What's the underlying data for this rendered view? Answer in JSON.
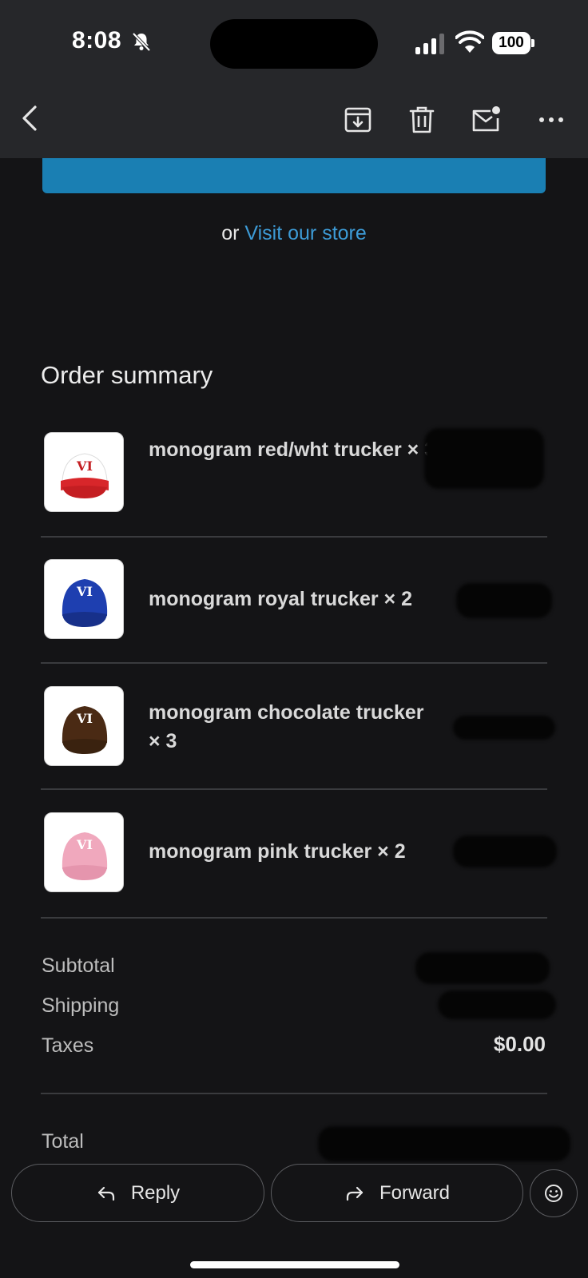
{
  "status_bar": {
    "time": "8:08",
    "battery": "100"
  },
  "toolbar": {
    "back_icon": "chevron-left-icon",
    "archive_icon": "archive-icon",
    "delete_icon": "trash-icon",
    "mark_unread_icon": "mail-unread-icon",
    "more_icon": "more-horizontal-icon"
  },
  "email": {
    "store_prefix": "or",
    "store_link": "Visit our store",
    "order_summary_title": "Order summary",
    "items": [
      {
        "name": "monogram red/wht trucker × 3",
        "cap_color": "#d8262a",
        "cap_front": "#ffffff"
      },
      {
        "name": "monogram royal trucker × 2",
        "cap_color": "#1e3fb0",
        "cap_front": "#1e3fb0"
      },
      {
        "name": "monogram chocolate trucker × 3",
        "cap_color": "#4a2a14",
        "cap_front": "#4a2a14"
      },
      {
        "name": "monogram pink trucker × 2",
        "cap_color": "#f0a8bd",
        "cap_front": "#f0a8bd"
      }
    ],
    "totals": {
      "subtotal_label": "Subtotal",
      "shipping_label": "Shipping",
      "taxes_label": "Taxes",
      "taxes_value": "$0.00",
      "total_label": "Total"
    }
  },
  "actions": {
    "reply_label": "Reply",
    "forward_label": "Forward",
    "emoji_icon": "emoji-reaction-icon"
  },
  "colors": {
    "background": "#141416",
    "toolbar": "#26272a",
    "link": "#3d9bd6",
    "cta": "#1a7fb3"
  }
}
